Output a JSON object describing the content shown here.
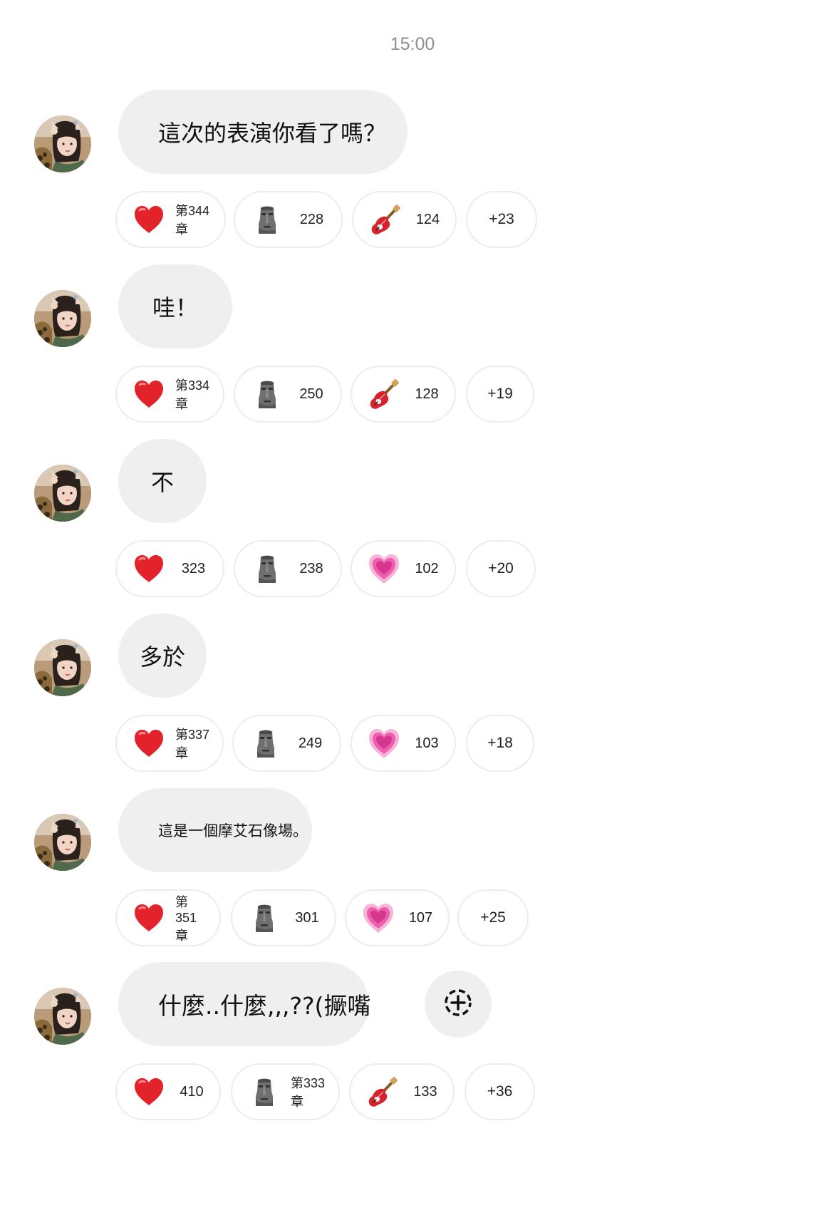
{
  "timestamp": "15:00",
  "icons": {
    "heart": "red-heart-icon",
    "moai": "moai-icon",
    "guitar": "guitar-icon",
    "pink_heart": "growing-heart-icon",
    "add": "add-reaction-icon"
  },
  "colors": {
    "bubble": "#efefef",
    "pill_border": "#ececec",
    "heart": "#e2232c",
    "pink_heart": "#e850a8",
    "timestamp": "#8e8e8e"
  },
  "messages": [
    {
      "text": "這次的表演你看了嗎？",
      "reactions": [
        {
          "icon": "heart",
          "count": "第344章"
        },
        {
          "icon": "moai",
          "count": "228"
        },
        {
          "icon": "guitar",
          "count": "124"
        },
        {
          "more": "+23"
        }
      ]
    },
    {
      "text": "哇！",
      "reactions": [
        {
          "icon": "heart",
          "count": "第334章"
        },
        {
          "icon": "moai",
          "count": "250"
        },
        {
          "icon": "guitar",
          "count": "128"
        },
        {
          "more": "+19"
        }
      ]
    },
    {
      "text": "不",
      "reactions": [
        {
          "icon": "heart",
          "count": "323"
        },
        {
          "icon": "moai",
          "count": "238"
        },
        {
          "icon": "pink_heart",
          "count": "102"
        },
        {
          "more": "+20"
        }
      ]
    },
    {
      "text": "多於",
      "reactions": [
        {
          "icon": "heart",
          "count": "第337章"
        },
        {
          "icon": "moai",
          "count": "249"
        },
        {
          "icon": "pink_heart",
          "count": "103"
        },
        {
          "more": "+18"
        }
      ]
    },
    {
      "text": "這是一個摩艾石像場。",
      "reactions": [
        {
          "icon": "heart",
          "count": "第351章"
        },
        {
          "icon": "moai",
          "count": "301"
        },
        {
          "icon": "pink_heart",
          "count": "107"
        },
        {
          "more": "+25"
        }
      ]
    },
    {
      "text": "什麼..什麼,,,??(撅嘴",
      "reactions": [
        {
          "icon": "heart",
          "count": "410"
        },
        {
          "icon": "moai",
          "count": "第333章"
        },
        {
          "icon": "guitar",
          "count": "133"
        },
        {
          "more": "+36"
        }
      ]
    }
  ]
}
